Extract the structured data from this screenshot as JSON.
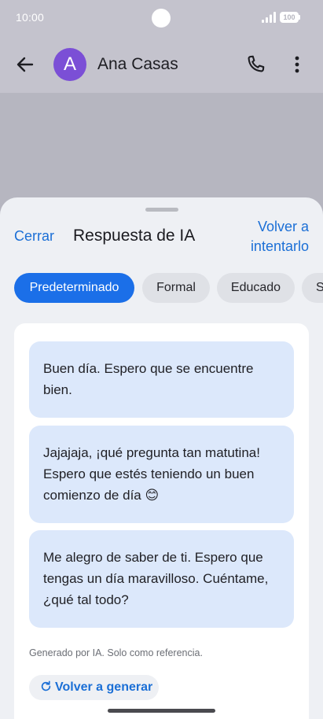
{
  "status_bar": {
    "time": "10:00",
    "battery": "100",
    "icons": [
      "signal-icon",
      "battery-icon"
    ]
  },
  "app_bar": {
    "avatar_letter": "A",
    "contact_name": "Ana Casas",
    "icons": [
      "back-arrow-icon",
      "phone-icon",
      "more-vert-icon"
    ],
    "avatar_color": "#7b4fd6"
  },
  "sheet": {
    "close_label": "Cerrar",
    "title": "Respuesta de IA",
    "retry_label": "Volver a intentarlo",
    "tones": [
      {
        "label": "Predeterminado",
        "selected": true
      },
      {
        "label": "Formal",
        "selected": false
      },
      {
        "label": "Educado",
        "selected": false
      },
      {
        "label": "S",
        "selected": false
      }
    ],
    "suggestions": [
      "Buen día. Espero que se encuentre bien.",
      "Jajajaja, ¡qué pregunta tan matutina! Espero que estés teniendo un buen comienzo de día 😊",
      "Me alegro de saber de ti. Espero que tengas un día maravilloso. Cuéntame, ¿qué tal todo?"
    ],
    "footnote": "Generado por IA. Solo como referencia.",
    "regenerate_label": "Volver a generar",
    "accent_color": "#1b6fe8"
  }
}
